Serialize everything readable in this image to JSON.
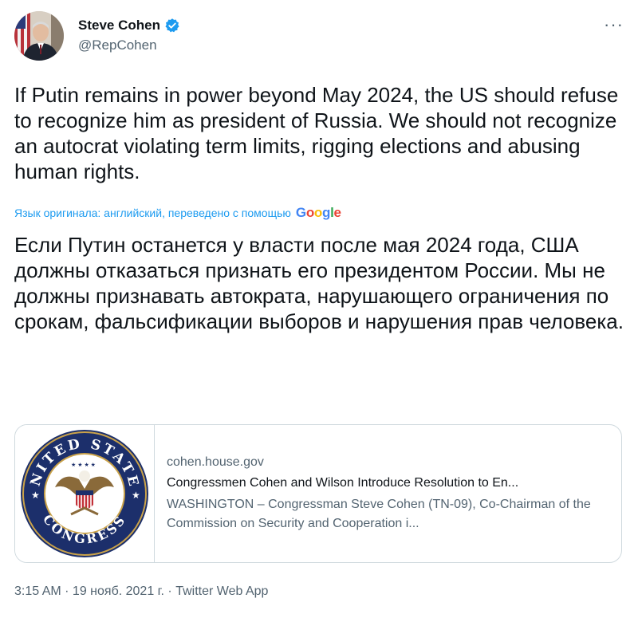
{
  "author": {
    "name": "Steve Cohen",
    "handle": "@RepCohen",
    "verified_icon": "verified-badge-icon",
    "more_label": "···"
  },
  "tweet": {
    "text": "If Putin remains in power beyond May 2024, the US should refuse to recognize him as president of Russia. We should not recognize an autocrat violating term limits, rigging elections and abusing human rights.",
    "translation_note": "Язык оригинала: английский, переведено с помощью",
    "translation_provider": "Google",
    "translated_text": "Если Путин останется у власти после мая 2024 года, США должны отказаться признать его президентом России. Мы не должны признавать автократа, нарушающего ограничения по срокам, фальсификации выборов и нарушения прав человека."
  },
  "card": {
    "domain": "cohen.house.gov",
    "title": "Congressmen Cohen and Wilson Introduce Resolution to En...",
    "description": "WASHINGTON – Congressman Steve Cohen (TN-09), Co-Chairman of the Commission on Security and Cooperation i...",
    "seal_top": "UNITED STATES",
    "seal_bottom": "CONGRESS"
  },
  "footer": {
    "meta": "3:15 AM · 19 нояб. 2021 г. · Twitter Web App"
  },
  "colors": {
    "accent": "#1d9bf0",
    "secondary_text": "#536471",
    "seal_blue": "#1c2f6b",
    "seal_gold": "#c9a24a"
  }
}
